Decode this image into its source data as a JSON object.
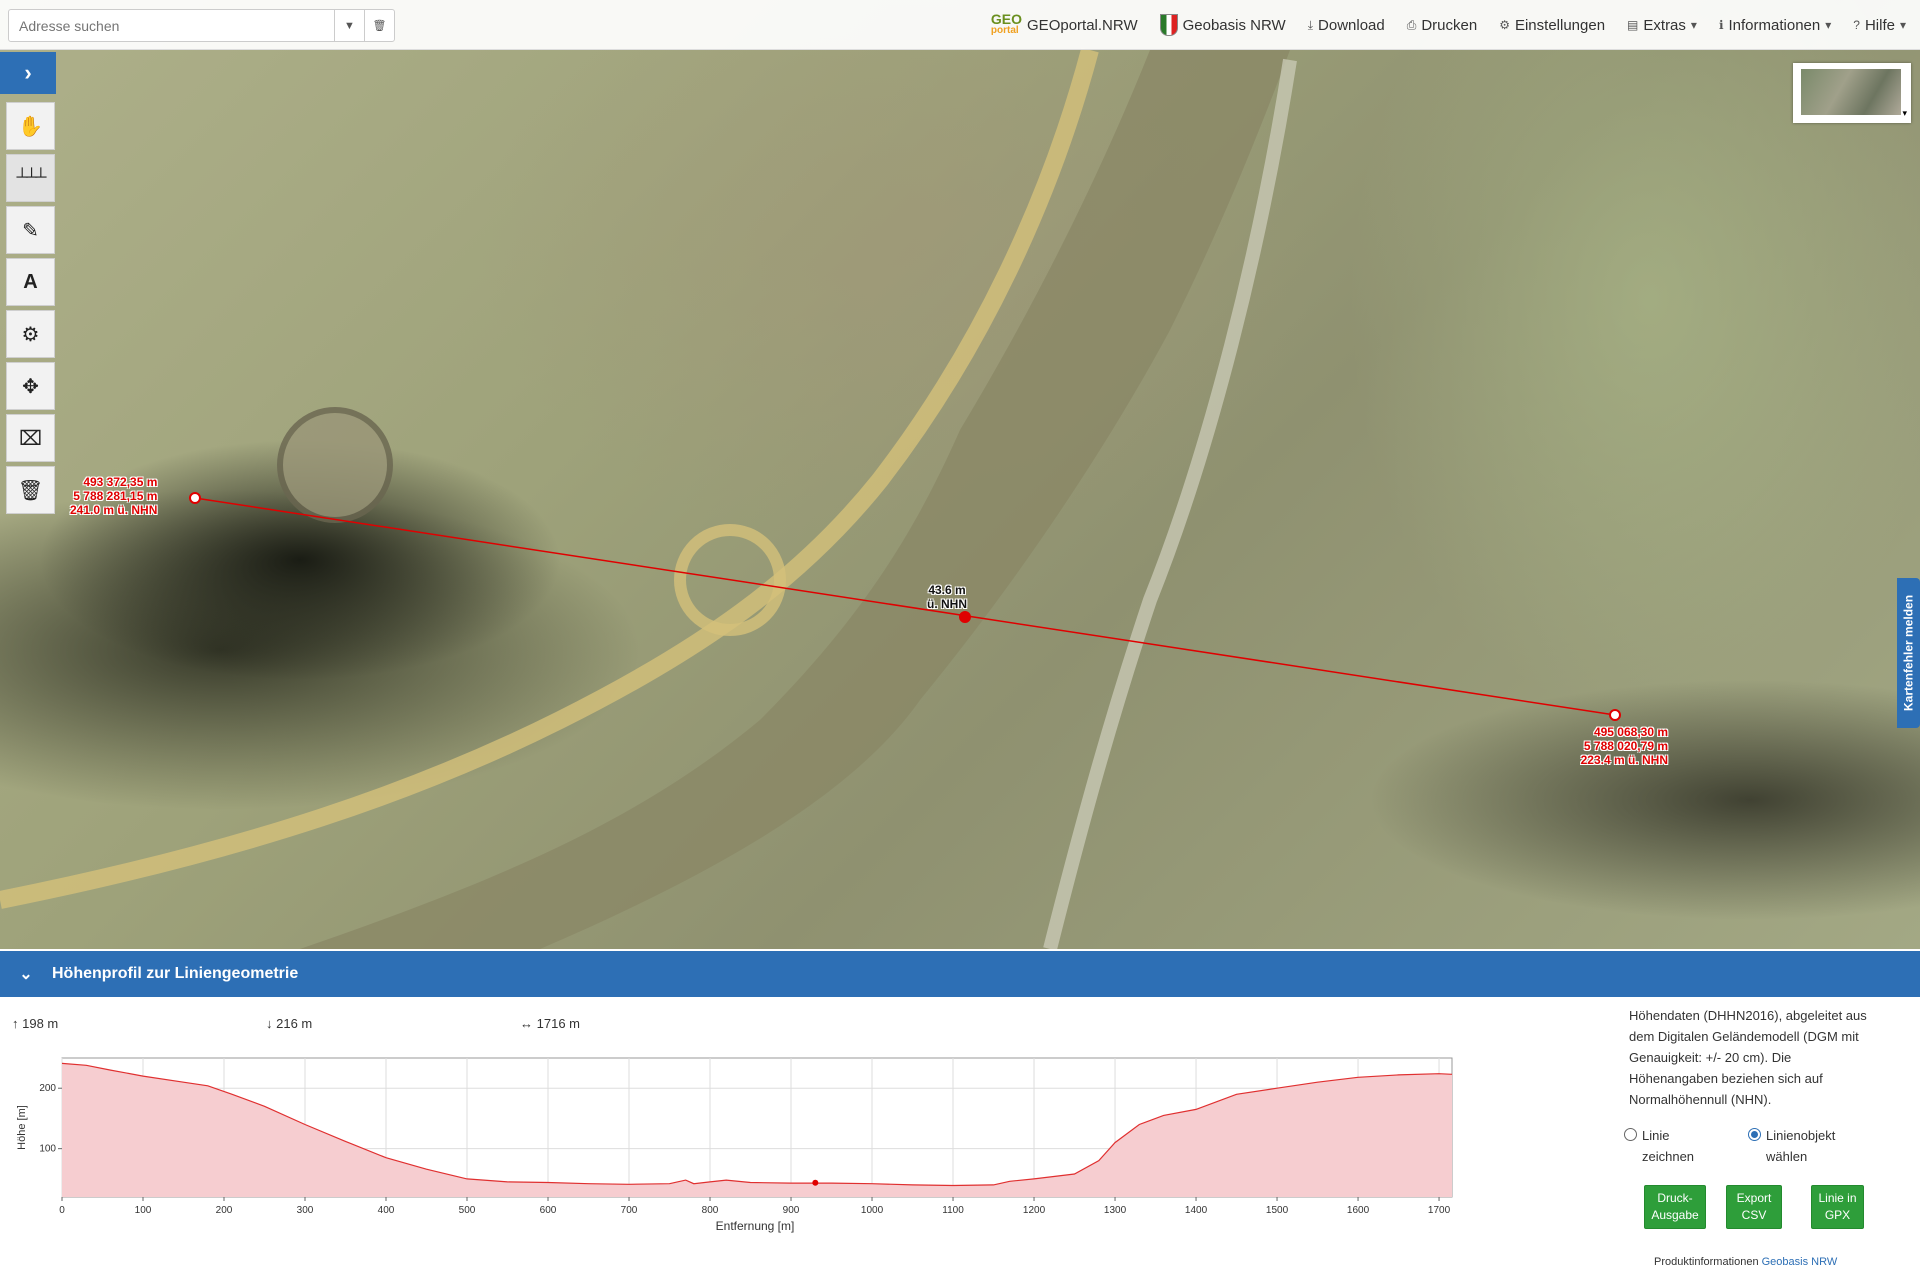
{
  "search": {
    "placeholder": "Adresse suchen"
  },
  "nav": [
    {
      "label": "GEOportal.NRW",
      "icon": "geoportal-logo"
    },
    {
      "label": "Geobasis NRW",
      "icon": "nrw-shield-icon"
    },
    {
      "label": "Download",
      "icon": "download-icon"
    },
    {
      "label": "Drucken",
      "icon": "print-icon"
    },
    {
      "label": "Einstellungen",
      "icon": "gear-icon"
    },
    {
      "label": "Extras",
      "icon": "toolbox-icon"
    },
    {
      "label": "Informationen",
      "icon": "info-icon"
    },
    {
      "label": "Hilfe",
      "icon": "help-icon"
    }
  ],
  "geo_logo": {
    "top": "GEO",
    "bottom": "portal"
  },
  "tools": [
    "hand-icon",
    "ruler-icon",
    "pencil-icon",
    "text-icon",
    "gear-icon",
    "move-icon",
    "eraser-select-icon",
    "trash-icon"
  ],
  "feedback_tab": "Kartenfehler melden",
  "markers": {
    "start": {
      "line1": "493 372,35 m",
      "line2": "5 788 281,15 m",
      "line3": "241.0 m ü. NHN"
    },
    "mid": {
      "line1": "43.6 m",
      "line2": "ü. NHN"
    },
    "end": {
      "line1": "495 068,30 m",
      "line2": "5 788 020,79 m",
      "line3": "223.4 m ü. NHN"
    }
  },
  "panel": {
    "title": "Höhenprofil zur Liniengeometrie",
    "stats": {
      "up": "198 m",
      "down": "216 m",
      "distance": "1716 m"
    },
    "info": "Höhendaten (DHHN2016), abgeleitet aus dem Digitalen Geländemodell (DGM mit Genauigkeit: +/- 20 cm). Die Höhenangaben beziehen sich auf Normalhöhennull (NHN).",
    "radio": [
      {
        "label": "Linie zeichnen",
        "checked": false
      },
      {
        "label": "Linienobjekt wählen",
        "checked": true
      }
    ],
    "buttons": [
      {
        "label": "Druck-Ausgabe"
      },
      {
        "label": "Export CSV"
      },
      {
        "label": "Linie in GPX"
      }
    ],
    "prodinfo": {
      "prefix": "Produktinformationen",
      "link": "Geobasis NRW"
    }
  },
  "chart_data": {
    "type": "area",
    "xlabel": "Entfernung [m]",
    "ylabel": "Höhe [m]",
    "xlim": [
      0,
      1716
    ],
    "ylim": [
      20,
      250
    ],
    "xticks": [
      0,
      100,
      200,
      300,
      400,
      500,
      600,
      700,
      800,
      900,
      1000,
      1100,
      1200,
      1300,
      1400,
      1500,
      1600,
      1700
    ],
    "yticks": [
      100,
      200
    ],
    "grid": true,
    "color": "#e03030",
    "fill": "#f6cdd0",
    "marker": {
      "x": 930,
      "y": 43.6
    },
    "x": [
      0,
      30,
      60,
      100,
      150,
      180,
      210,
      250,
      300,
      350,
      400,
      450,
      500,
      550,
      600,
      650,
      700,
      750,
      770,
      780,
      800,
      820,
      850,
      900,
      930,
      950,
      1000,
      1050,
      1100,
      1150,
      1170,
      1200,
      1250,
      1280,
      1300,
      1330,
      1360,
      1400,
      1450,
      1500,
      1550,
      1600,
      1650,
      1700,
      1716
    ],
    "y": [
      241,
      238,
      230,
      220,
      210,
      204,
      190,
      170,
      140,
      112,
      85,
      66,
      50,
      45,
      44,
      42,
      41,
      42,
      48,
      42,
      45,
      48,
      44,
      43,
      43,
      43,
      42,
      40,
      39,
      40,
      46,
      50,
      58,
      80,
      110,
      140,
      155,
      165,
      190,
      200,
      210,
      218,
      222,
      224,
      223
    ]
  }
}
